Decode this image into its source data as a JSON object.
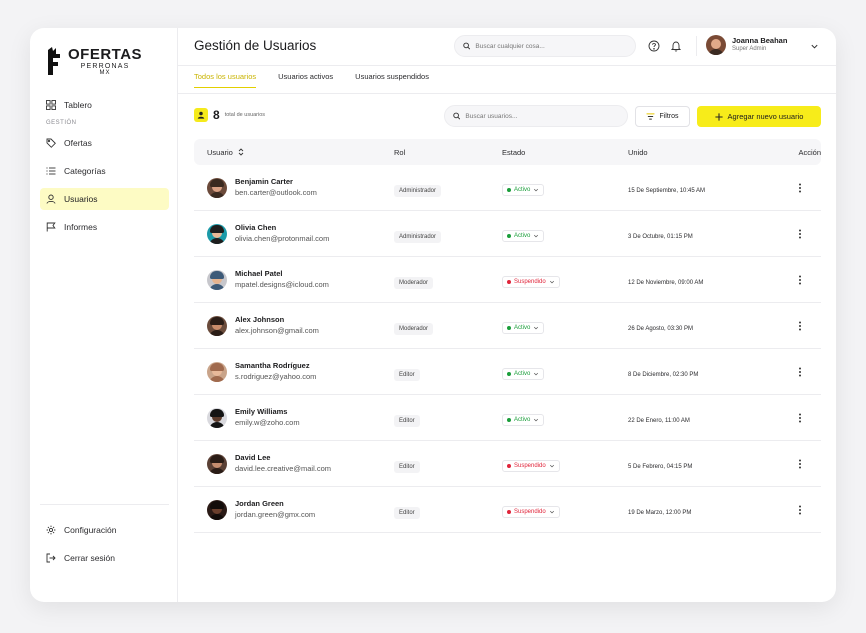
{
  "brand": {
    "title": "OFERTAS",
    "sub1": "PERRONAS",
    "sub2": "MX"
  },
  "sidebar": {
    "items": [
      {
        "label": "Tablero",
        "icon": "grid-icon"
      },
      {
        "label": "Ofertas",
        "icon": "tag-icon"
      },
      {
        "label": "Categorías",
        "icon": "list-icon"
      },
      {
        "label": "Usuarios",
        "icon": "user-icon"
      },
      {
        "label": "Informes",
        "icon": "flag-icon"
      }
    ],
    "section_label": "GESTIÓN",
    "bottom": [
      {
        "label": "Configuración",
        "icon": "gear-icon"
      },
      {
        "label": "Cerrar sesión",
        "icon": "logout-icon"
      }
    ]
  },
  "header": {
    "title": "Gestión de Usuarios",
    "search_placeholder": "Buscar cualquier cosa...",
    "user_name": "Joanna Beahan",
    "user_role": "Super Admin"
  },
  "tabs": [
    "Todos los usuarios",
    "Usuarios activos",
    "Usuarios suspendidos"
  ],
  "summary": {
    "count": "8",
    "label": "total de usuarios"
  },
  "toolbar": {
    "search_placeholder": "Buscar usuarios...",
    "filter_label": "Filtros",
    "add_label": "Agregar nuevo usuario"
  },
  "table": {
    "headers": {
      "user": "Usuario",
      "role": "Rol",
      "state": "Estado",
      "joined": "Unido",
      "action": "Acción"
    },
    "rows": [
      {
        "name": "Benjamin Carter",
        "email": "ben.carter@outlook.com",
        "role": "Administrador",
        "state": "Activo",
        "status": "active",
        "date": "15 De Septiembre, 10:45 AM"
      },
      {
        "name": "Olivia Chen",
        "email": "olivia.chen@protonmail.com",
        "role": "Administrador",
        "state": "Activo",
        "status": "active",
        "date": "3 De Octubre, 01:15 PM"
      },
      {
        "name": "Michael Patel",
        "email": "mpatel.designs@icloud.com",
        "role": "Moderador",
        "state": "Suspendido",
        "status": "suspended",
        "date": "12 De Noviembre, 09:00 AM"
      },
      {
        "name": "Alex Johnson",
        "email": "alex.johnson@gmail.com",
        "role": "Moderador",
        "state": "Activo",
        "status": "active",
        "date": "26 De Agosto, 03:30 PM"
      },
      {
        "name": "Samantha Rodríguez",
        "email": "s.rodriguez@yahoo.com",
        "role": "Editor",
        "state": "Activo",
        "status": "active",
        "date": "8 De Diciembre, 02:30 PM"
      },
      {
        "name": "Emily Williams",
        "email": "emily.w@zoho.com",
        "role": "Editor",
        "state": "Activo",
        "status": "active",
        "date": "22 De Enero, 11:00 AM"
      },
      {
        "name": "David Lee",
        "email": "david.lee.creative@mail.com",
        "role": "Editor",
        "state": "Suspendido",
        "status": "suspended",
        "date": "5 De Febrero, 04:15 PM"
      },
      {
        "name": "Jordan Green",
        "email": "jordan.green@gmx.com",
        "role": "Editor",
        "state": "Suspendido",
        "status": "suspended",
        "date": "19 De Marzo, 12:00 PM"
      }
    ]
  },
  "colors": {
    "accent": "#f7ec1a",
    "active": "#1a9e3a",
    "suspended": "#e0243a"
  }
}
